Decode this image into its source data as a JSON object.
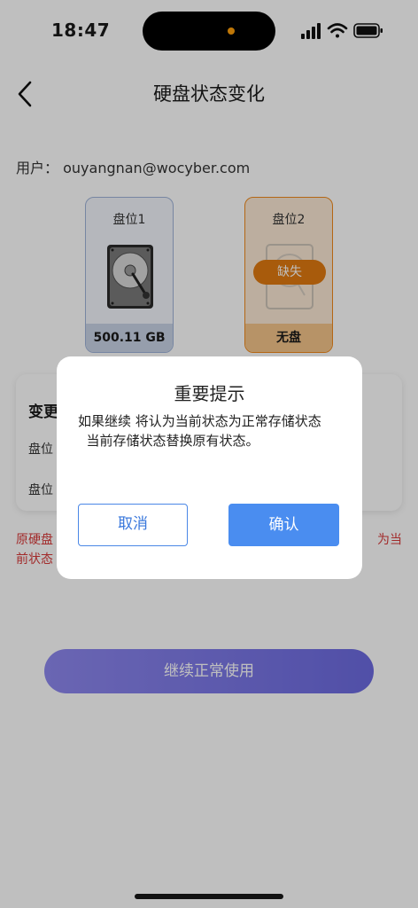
{
  "status_bar": {
    "time": "18:47"
  },
  "nav": {
    "title": "硬盘状态变化"
  },
  "user": {
    "label": "用户：",
    "email": "ouyangnan@wocyber.com"
  },
  "slots": [
    {
      "label": "盘位1",
      "footer": "500.11 GB"
    },
    {
      "label": "盘位2",
      "footer": "无盘",
      "badge": "缺失"
    }
  ],
  "change_card": {
    "title": "变更",
    "row1": "盘位",
    "row2": "盘位"
  },
  "warning": {
    "line1_left": "原硬盘",
    "line1_right": "为当",
    "line2_left": "前状态"
  },
  "primary_button": {
    "label": "继续正常使用"
  },
  "dialog": {
    "title": "重要提示",
    "message_line1": "如果继续  将认为当前状态为正常存储状态",
    "message_line2": "  当前存储状态替换原有状态。",
    "cancel_label": "取消",
    "confirm_label": "确认"
  },
  "colors": {
    "accent": "#4a8df0",
    "warning": "#d83a3a",
    "slot_missing": "#e07a10",
    "primary_gradient_start": "#8e88ef",
    "primary_gradient_end": "#6c6ae0"
  }
}
